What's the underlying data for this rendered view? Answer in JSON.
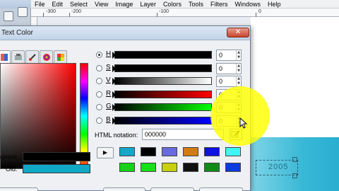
{
  "menubar": {
    "items": [
      "File",
      "Edit",
      "Select",
      "View",
      "Image",
      "Layer",
      "Colors",
      "Tools",
      "Filters",
      "Windows",
      "Help"
    ]
  },
  "ruler": {
    "labels": [
      "-300",
      "-200",
      "-100",
      "0"
    ]
  },
  "dialog": {
    "title": "Text Color",
    "close_icon": "close-x-icon",
    "tabs": [
      "gimp-selector-icon",
      "cmyk-selector-icon",
      "watercolor-selector-icon",
      "color-wheel-selector-icon",
      "palette-selector-icon"
    ],
    "channels": [
      {
        "label": "H",
        "value": "0",
        "checked": true
      },
      {
        "label": "S",
        "value": "0",
        "checked": false
      },
      {
        "label": "V",
        "value": "0",
        "checked": false
      },
      {
        "label": "R",
        "value": "0",
        "checked": false
      },
      {
        "label": "G",
        "value": "0",
        "checked": false
      },
      {
        "label": "B",
        "value": "0",
        "checked": false
      }
    ],
    "html_notation_label": "HTML notation:",
    "html_notation_value": "000000",
    "history_colors": [
      "#16a6c8",
      "#000000",
      "#6a6adc",
      "#d07c12",
      "#1010e0",
      "#3ef6f6",
      "#18d018",
      "#16e016",
      "#c8d010",
      "#101010",
      "#108a18",
      "#0a3ae0"
    ],
    "current_label": "urrent:",
    "old_label": "Old:",
    "current_color": "#000000",
    "old_color": "#11a8c6"
  },
  "colors": {
    "highlight": "#ffff00",
    "close_button": "#c9462f"
  },
  "canvas": {
    "text_layer": "2005"
  }
}
